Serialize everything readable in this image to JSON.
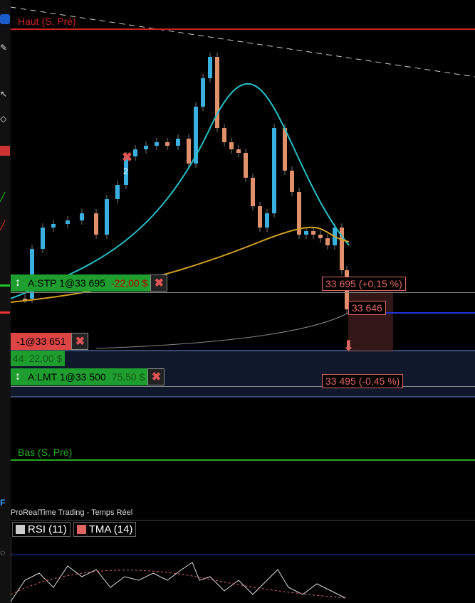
{
  "chart": {
    "high_label": "Haut (S, Pré)",
    "low_label": "Bas (S, Pré)",
    "high_color": "#cc2222",
    "low_color": "#22aa22"
  },
  "orders": {
    "stop": {
      "name": "A:STP 1@33 695",
      "pnl": "-22,00 $"
    },
    "position": {
      "name": "-1@33 651",
      "qty": "44",
      "pnl": "22,00 $"
    },
    "limit": {
      "name": "A:LMT 1@33 500",
      "pnl": "75,50 $"
    }
  },
  "price_tags": {
    "stop": "33 695 (+0,15 %)",
    "current": "33 646",
    "limit": "33 495 (-0,45 %)"
  },
  "trade_marker": {
    "count": "2"
  },
  "status": {
    "text": "ProRealTime Trading - Temps Réel"
  },
  "indicators": [
    {
      "label": "RSI (11)",
      "color": "#cccccc"
    },
    {
      "label": "TMA (14)",
      "color": "#e06666"
    }
  ],
  "toolbar_icons": [
    "cursor-icon",
    "pencil-icon",
    "crosshair-icon",
    "magnet-icon",
    "line-icon",
    "trend-line-icon",
    "ray-icon",
    "horizontal-line-icon",
    "fibonacci-icon",
    "text-icon",
    "ellipse-icon"
  ]
}
